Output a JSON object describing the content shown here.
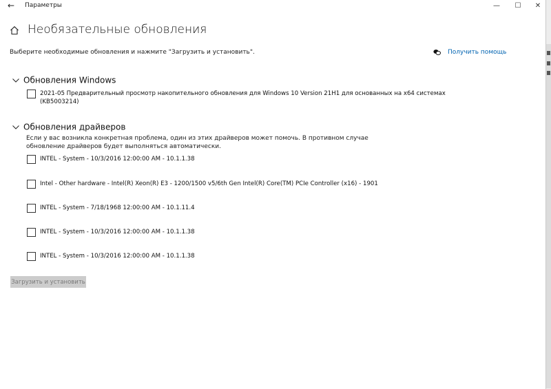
{
  "window": {
    "app_title": "Параметры",
    "back_glyph": "←",
    "controls": {
      "minimize": "—",
      "maximize": "☐",
      "close": "✕"
    }
  },
  "page": {
    "title": "Необязательные обновления",
    "instruction": "Выберите необходимые обновления и нажмите \"Загрузить и установить\".",
    "help_link": "Получить помощь"
  },
  "windows_updates": {
    "title": "Обновления Windows",
    "items": [
      {
        "line1": "2021-05 Предварительный просмотр накопительного обновления для Windows 10 Version 21H1 для основанных на x64 системах",
        "line2": "(KB5003214)",
        "checked": false
      }
    ]
  },
  "driver_updates": {
    "title": "Обновления драйверов",
    "description": "Если у вас возникла конкретная проблема, один из этих драйверов может помочь. В противном случае обновление драйверов будет выполняться автоматически.",
    "items": [
      {
        "label": "INTEL - System - 10/3/2016 12:00:00 AM - 10.1.1.38",
        "checked": false
      },
      {
        "label": "Intel - Other hardware - Intel(R) Xeon(R) E3 - 1200/1500 v5/6th Gen Intel(R) Core(TM) PCIe Controller (x16) - 1901",
        "checked": false
      },
      {
        "label": "INTEL - System - 7/18/1968 12:00:00 AM - 10.1.11.4",
        "checked": false
      },
      {
        "label": "INTEL - System - 10/3/2016 12:00:00 AM - 10.1.1.38",
        "checked": false
      },
      {
        "label": "INTEL - System - 10/3/2016 12:00:00 AM - 10.1.1.38",
        "checked": false
      }
    ]
  },
  "install_button": {
    "label": "Загрузить и установить",
    "enabled": false
  },
  "colors": {
    "link": "#0063b1",
    "disabled_button_bg": "#cccccc",
    "disabled_button_text": "#7a7a7a"
  }
}
